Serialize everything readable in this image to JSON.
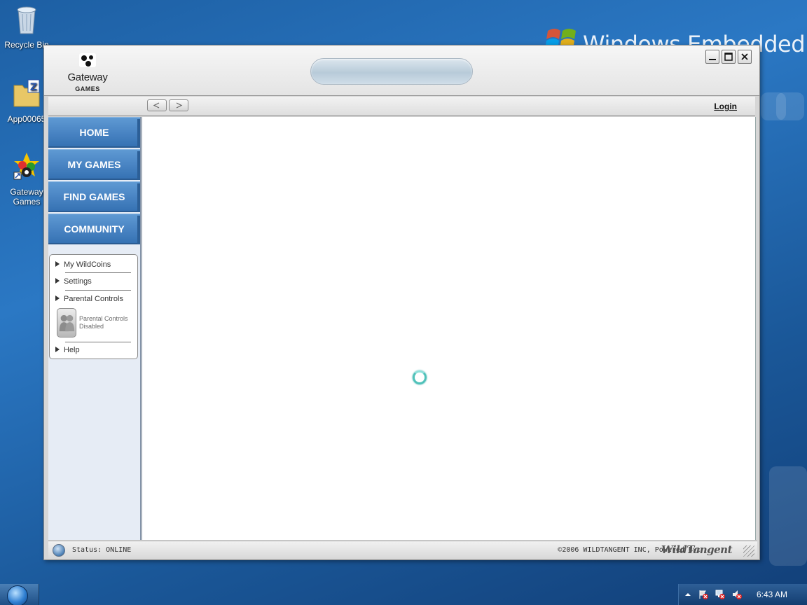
{
  "desktop": {
    "icons": [
      {
        "label": "Recycle Bin",
        "icon": "recycle-bin-icon"
      },
      {
        "label": "App00065",
        "icon": "zip-folder-icon"
      },
      {
        "label": "Gateway Games",
        "icon": "gateway-games-icon"
      }
    ],
    "brand_text": "Windows Embedded"
  },
  "window": {
    "logo_name": "Gateway",
    "logo_sub": "GAMES",
    "controls": [
      "minimize",
      "maximize",
      "close"
    ],
    "toolbar": {
      "back_label": "◄",
      "forward_label": "►",
      "login": "Login"
    },
    "menu": [
      "HOME",
      "MY GAMES",
      "FIND GAMES",
      "COMMUNITY"
    ],
    "panel": {
      "items": [
        "My WildCoins",
        "Settings",
        "Parental Controls",
        "Help"
      ],
      "parental_status": "Parental Controls Disabled"
    },
    "statusbar": {
      "status": "Status: ONLINE",
      "copyright": "©2006 WILDTANGENT INC, Powered By:",
      "powered_logo": "WildTangent"
    }
  },
  "taskbar": {
    "clock": "6:43 AM",
    "tray_icons": [
      "show-hidden-icons-arrow",
      "action-center-error-icon",
      "network-error-icon",
      "volume-muted-icon"
    ]
  },
  "colors": {
    "menu_blue": "#4a85c4",
    "desktop_blue": "#2b78c4",
    "spinner": "#4fc1b9"
  }
}
